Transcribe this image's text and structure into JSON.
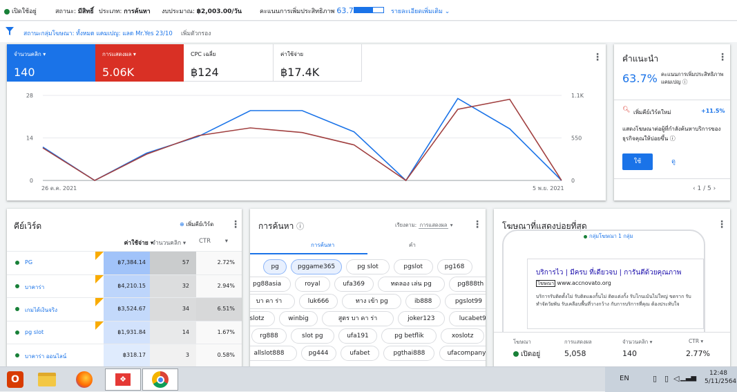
{
  "topbar": {
    "status": "เปิดใช้อยู่",
    "status_label": "สถานะ:",
    "status_value": "มีสิทธิ์",
    "type_label": "ประเภท:",
    "type_value": "การค้นหา",
    "budget_label": "งบประมาณ:",
    "budget_value": "฿2,003.00/วัน",
    "optscore_label": "คะแนนการเพิ่มประสิทธิภาพ",
    "optscore_value": "63.7%",
    "optscore_fraction": 0.637,
    "details_link": "รายละเอียดเพิ่มเติม"
  },
  "filterbar": {
    "filter_text": "สถานะกลุ่มโฆษณา: ทั้งหมด แคมเปญ: แลด Mr.Yes 23/10",
    "add_filter": "เพิ่มตัวกรอง"
  },
  "metrics": [
    {
      "label": "จำนวนคลิก",
      "value": "140",
      "color": "#1a73e8"
    },
    {
      "label": "การแสดงผล",
      "value": "5.06K",
      "color": "#d93025"
    },
    {
      "label": "CPC เฉลี่ย",
      "value": "฿124",
      "color": "#ffffff"
    },
    {
      "label": "ค่าใช้จ่าย",
      "value": "฿17.4K",
      "color": "#ffffff"
    }
  ],
  "chart_data": {
    "type": "line",
    "x_labels": [
      "26 ต.ค. 2021",
      "5 พ.ย. 2021"
    ],
    "left_axis_ticks": [
      "28",
      "14",
      "0"
    ],
    "right_axis_ticks": [
      "1.1K",
      "550",
      "0"
    ],
    "series": [
      {
        "color": "#1a73e8",
        "axis": "left",
        "values": [
          11,
          0,
          9,
          14.5,
          23,
          23,
          16,
          0,
          27,
          17,
          0
        ]
      },
      {
        "color": "#a14040",
        "axis": "right",
        "values": [
          420,
          0,
          340,
          580,
          680,
          620,
          460,
          0,
          920,
          1050,
          0
        ]
      }
    ],
    "ylim_left": [
      0,
      28
    ],
    "ylim_right": [
      0,
      1100
    ]
  },
  "recommendations": {
    "title": "คำแนะนำ",
    "score": "63.7%",
    "score_label": "คะแนนการเพิ่มประสิทธิภาพแคมเปญ",
    "item_title": "เพิ่มคีย์เวิร์ดใหม่",
    "item_uplift": "+11.5%",
    "item_desc": "แสดงโฆษณาต่อผู้ที่กำลังค้นหาบริการของธุรกิจคุณให้บ่อยขึ้น",
    "apply": "ใช้",
    "view": "ดู",
    "pager": "1 / 5"
  },
  "keywords": {
    "title": "คีย์เวิร์ด",
    "add": "เพิ่มคีย์เวิร์ด",
    "columns": [
      "ค่าใช้จ่าย",
      "จำนวนคลิก",
      "CTR"
    ],
    "rows": [
      {
        "name": "PG",
        "cost": "฿7,384.14",
        "clicks": "57",
        "ctr": "2.72%"
      },
      {
        "name": "บาคาร่า",
        "cost": "฿4,210.15",
        "clicks": "32",
        "ctr": "2.94%"
      },
      {
        "name": "เกมได้เงินจริง",
        "cost": "฿3,524.67",
        "clicks": "34",
        "ctr": "6.51%"
      },
      {
        "name": "pg slot",
        "cost": "฿1,931.84",
        "clicks": "14",
        "ctr": "1.67%"
      },
      {
        "name": "บาคาร่า ออนไลน์",
        "cost": "฿318.17",
        "clicks": "3",
        "ctr": "0.58%"
      }
    ]
  },
  "searches": {
    "title": "การค้นหา",
    "sort_label": "เรียงตาม:",
    "sort_value": "การแสดงผล",
    "tab_searches": "การค้นหา",
    "tab_words": "คำ",
    "terms": [
      "pg",
      "pggame365",
      "pg slot",
      "pgslot",
      "pg168",
      "pg88asia",
      "royal",
      "ufa369",
      "ทดลอง เล่น pg",
      "pg888th",
      "บา คา ร่า",
      "luk666",
      "ทาง เข้า pg",
      "ib888",
      "pgslot99",
      "pgslotz",
      "winbig",
      "สูตร บา คา ร่า",
      "joker123",
      "lucabet999",
      "rg888",
      "slot pg",
      "ufa191",
      "pg betflik",
      "xoslotz",
      "allslot888",
      "pg444",
      "ufabet",
      "pgthai888",
      "ufacompany"
    ]
  },
  "ads": {
    "title": "โฆษณาที่แสดงบ่อยที่สุด",
    "group_badge": "กลุ่มโฆษณา 1 กลุ่ม",
    "headline": "บริการไว | มีครบ ที่เดียวจบ | การันตีด้วยคุณภาพ",
    "ad_badge": "โฆษณา",
    "url": "www.accnovato.org",
    "description": "บริการรับติดตั้งไม่ รับติดแผงกั้นไม่ ติดแต่งกั้ง รับโกนเม้นไม่ใหญ่ ขดราก รับทำจัดวัยพัน รับเคลือบพื้นที่วางกว้าง กับการบริการที่คุณ ต้องประทับใจ",
    "stat_labels": [
      "โฆษณา",
      "การแสดงผล",
      "จำนวนคลิก",
      "CTR"
    ],
    "stat_values": [
      "เปิดอยู่",
      "5,058",
      "140",
      "2.77%"
    ]
  },
  "taskbar": {
    "lang": "EN",
    "time": "12:48",
    "date": "5/11/2564"
  }
}
